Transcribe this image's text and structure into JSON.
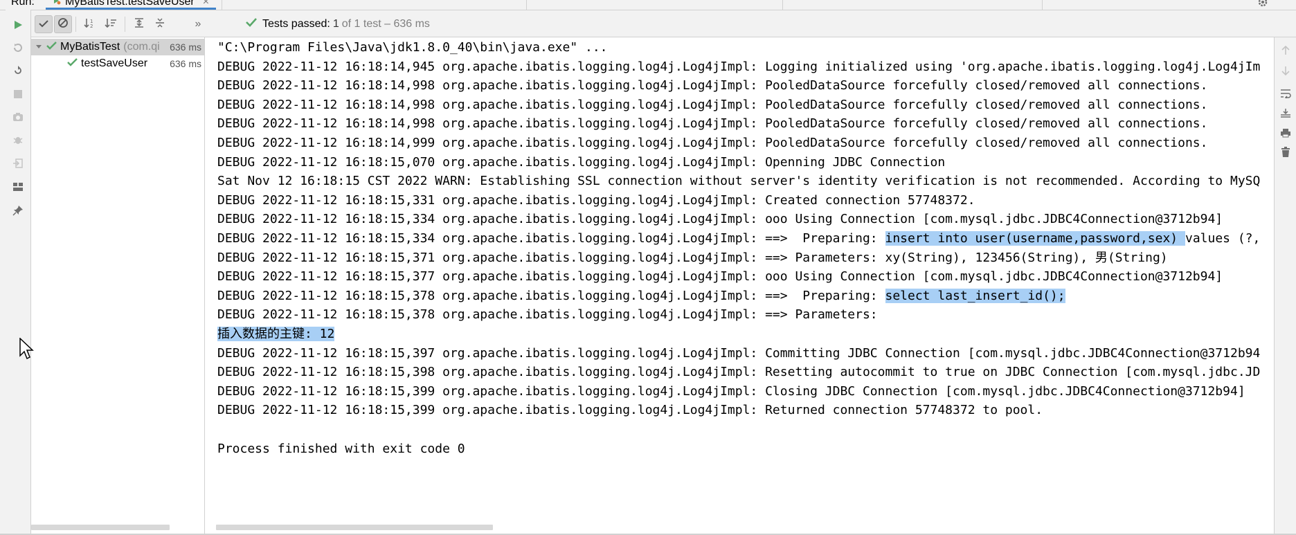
{
  "window": {
    "run_label": "Run:",
    "tab_title": "MyBatisTest.testSaveUser",
    "tab_close": "×"
  },
  "toolbar": {
    "status_label": "Tests passed:",
    "status_count": "1",
    "status_rest": "of 1 test – 636 ms",
    "more": "»"
  },
  "tree": {
    "suite": {
      "name": "MyBatisTest",
      "pkg": "(com.qi",
      "time": "636 ms"
    },
    "test": {
      "name": "testSaveUser",
      "time": "636 ms"
    }
  },
  "console": {
    "lines": [
      {
        "text": "\"C:\\Program Files\\Java\\jdk1.8.0_40\\bin\\java.exe\" ...",
        "kind": "cmd"
      },
      {
        "text": "DEBUG 2022-11-12 16:18:14,945 org.apache.ibatis.logging.log4j.Log4jImpl: Logging initialized using 'org.apache.ibatis.logging.log4j.Log4jIm",
        "kind": "log"
      },
      {
        "text": "DEBUG 2022-11-12 16:18:14,998 org.apache.ibatis.logging.log4j.Log4jImpl: PooledDataSource forcefully closed/removed all connections.",
        "kind": "log"
      },
      {
        "text": "DEBUG 2022-11-12 16:18:14,998 org.apache.ibatis.logging.log4j.Log4jImpl: PooledDataSource forcefully closed/removed all connections.",
        "kind": "log"
      },
      {
        "text": "DEBUG 2022-11-12 16:18:14,998 org.apache.ibatis.logging.log4j.Log4jImpl: PooledDataSource forcefully closed/removed all connections.",
        "kind": "log"
      },
      {
        "text": "DEBUG 2022-11-12 16:18:14,999 org.apache.ibatis.logging.log4j.Log4jImpl: PooledDataSource forcefully closed/removed all connections.",
        "kind": "log"
      },
      {
        "text": "DEBUG 2022-11-12 16:18:15,070 org.apache.ibatis.logging.log4j.Log4jImpl: Openning JDBC Connection",
        "kind": "log"
      },
      {
        "text": "Sat Nov 12 16:18:15 CST 2022 WARN: Establishing SSL connection without server's identity verification is not recommended. According to MySQ",
        "kind": "warn"
      },
      {
        "text": "DEBUG 2022-11-12 16:18:15,331 org.apache.ibatis.logging.log4j.Log4jImpl: Created connection 57748372.",
        "kind": "log"
      },
      {
        "text": "DEBUG 2022-11-12 16:18:15,334 org.apache.ibatis.logging.log4j.Log4jImpl: ooo Using Connection [com.mysql.jdbc.JDBC4Connection@3712b94]",
        "kind": "log"
      },
      {
        "pre": "DEBUG 2022-11-12 16:18:15,334 org.apache.ibatis.logging.log4j.Log4jImpl: ==>  Preparing: ",
        "hl": "insert into user(username,password,sex) ",
        "post": "values (?,",
        "kind": "split"
      },
      {
        "text": "DEBUG 2022-11-12 16:18:15,371 org.apache.ibatis.logging.log4j.Log4jImpl: ==> Parameters: xy(String), 123456(String), 男(String)",
        "kind": "log"
      },
      {
        "text": "DEBUG 2022-11-12 16:18:15,377 org.apache.ibatis.logging.log4j.Log4jImpl: ooo Using Connection [com.mysql.jdbc.JDBC4Connection@3712b94]",
        "kind": "log"
      },
      {
        "pre": "DEBUG 2022-11-12 16:18:15,378 org.apache.ibatis.logging.log4j.Log4jImpl: ==>  Preparing: ",
        "hl": "select last_insert_id();",
        "post": "",
        "kind": "split"
      },
      {
        "text": "DEBUG 2022-11-12 16:18:15,378 org.apache.ibatis.logging.log4j.Log4jImpl: ==> Parameters: ",
        "kind": "log"
      },
      {
        "pre": "",
        "hl": "插入数据的主键: 12",
        "post": "",
        "kind": "split"
      },
      {
        "text": "DEBUG 2022-11-12 16:18:15,397 org.apache.ibatis.logging.log4j.Log4jImpl: Committing JDBC Connection [com.mysql.jdbc.JDBC4Connection@3712b94",
        "kind": "log"
      },
      {
        "text": "DEBUG 2022-11-12 16:18:15,398 org.apache.ibatis.logging.log4j.Log4jImpl: Resetting autocommit to true on JDBC Connection [com.mysql.jdbc.JD",
        "kind": "log"
      },
      {
        "text": "DEBUG 2022-11-12 16:18:15,399 org.apache.ibatis.logging.log4j.Log4jImpl: Closing JDBC Connection [com.mysql.jdbc.JDBC4Connection@3712b94]",
        "kind": "log"
      },
      {
        "text": "DEBUG 2022-11-12 16:18:15,399 org.apache.ibatis.logging.log4j.Log4jImpl: Returned connection 57748372 to pool.",
        "kind": "log"
      },
      {
        "text": "",
        "kind": "log"
      },
      {
        "text": "Process finished with exit code 0",
        "kind": "exit"
      }
    ]
  },
  "colors": {
    "pass_green": "#59a869",
    "accent_blue": "#4083c9",
    "highlight": "#a8cff5",
    "warn_red": "#b0241c"
  }
}
